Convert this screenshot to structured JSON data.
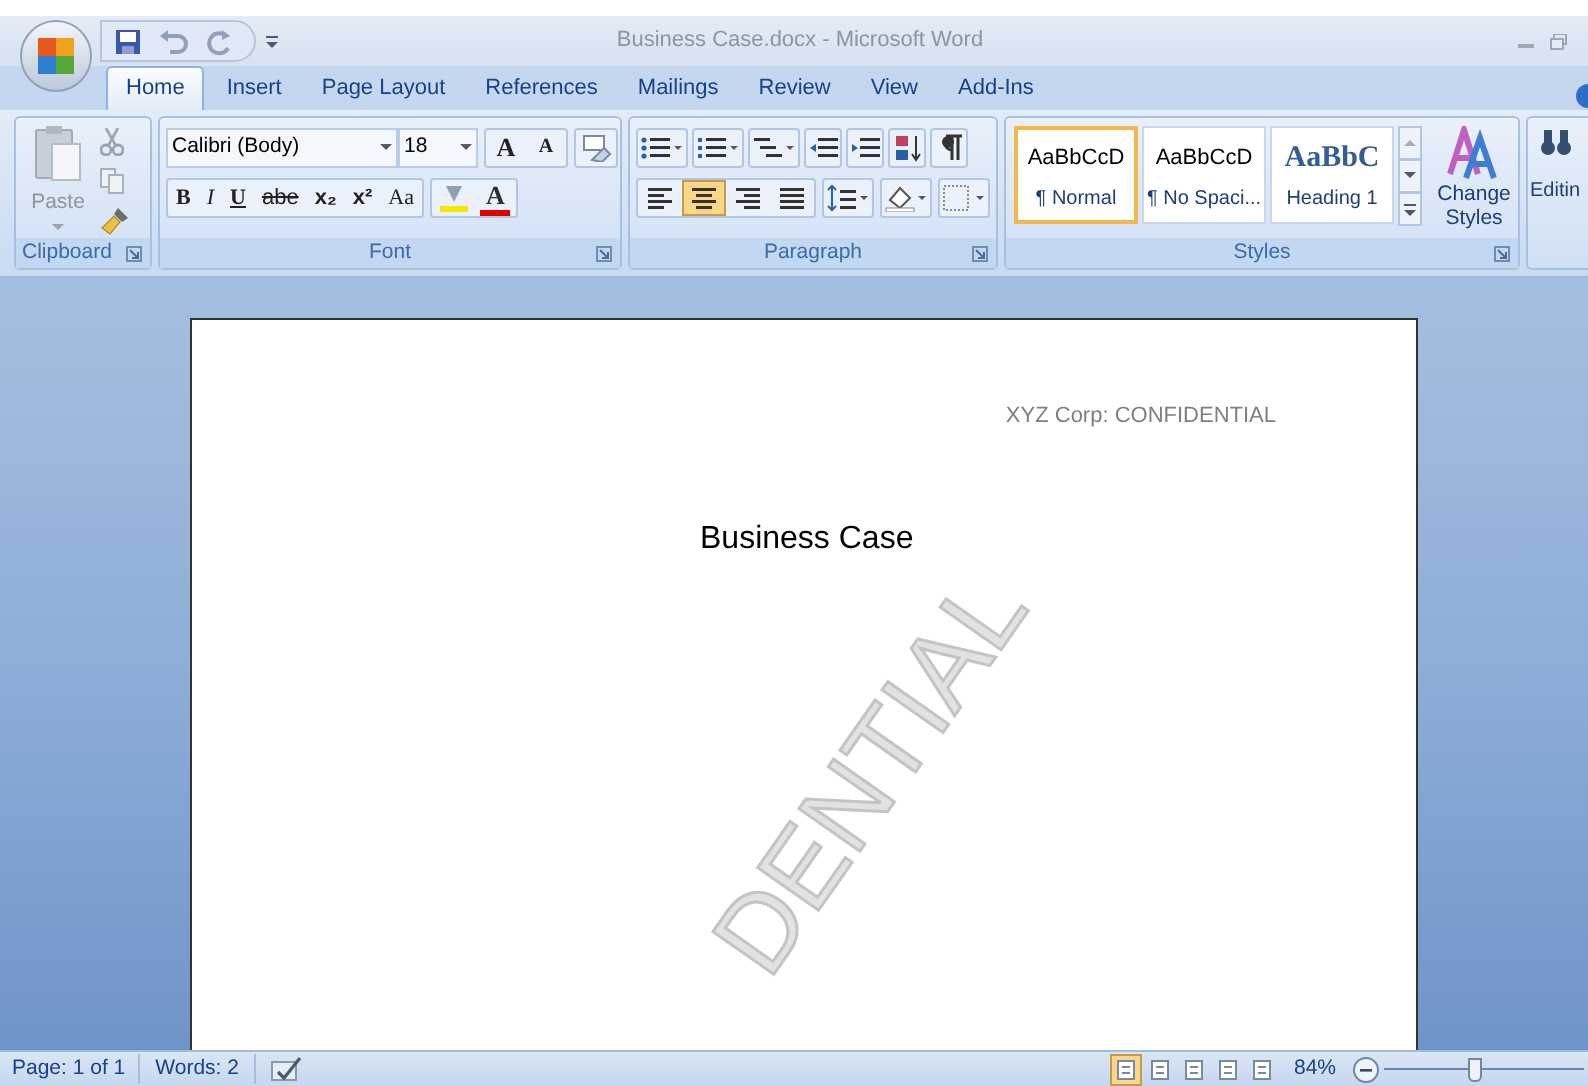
{
  "window": {
    "title": "Business Case.docx - Microsoft Word"
  },
  "tabs": [
    {
      "label": "Home",
      "selected": true
    },
    {
      "label": "Insert",
      "selected": false
    },
    {
      "label": "Page Layout",
      "selected": false
    },
    {
      "label": "References",
      "selected": false
    },
    {
      "label": "Mailings",
      "selected": false
    },
    {
      "label": "Review",
      "selected": false
    },
    {
      "label": "View",
      "selected": false
    },
    {
      "label": "Add-Ins",
      "selected": false
    }
  ],
  "clipboard": {
    "label": "Clipboard",
    "paste": "Paste"
  },
  "font": {
    "label": "Font",
    "font_name": "Calibri (Body)",
    "font_size": "18",
    "grow": "A",
    "shrink": "A",
    "format_buttons": [
      "B",
      "I",
      "U",
      "abe",
      "x₂",
      "x²",
      "Aa"
    ],
    "font_color": "A"
  },
  "paragraph": {
    "label": "Paragraph",
    "alignments": [
      {
        "kind": "left",
        "selected": false
      },
      {
        "kind": "center",
        "selected": true
      },
      {
        "kind": "right",
        "selected": false
      },
      {
        "kind": "justify",
        "selected": false
      }
    ]
  },
  "styles": {
    "label": "Styles",
    "items": [
      {
        "kind": "body",
        "preview": "AaBbCcD",
        "name": "¶ Normal",
        "selected": true
      },
      {
        "kind": "body",
        "preview": "AaBbCcD",
        "name": "¶ No Spaci...",
        "selected": false
      },
      {
        "kind": "heading",
        "preview": "AaBbC",
        "name": "Heading 1",
        "selected": false
      }
    ],
    "change_styles": "Change Styles"
  },
  "editing": {
    "label": "Editin"
  },
  "document": {
    "header": "XYZ Corp: CONFIDENTIAL",
    "title": "Business Case",
    "watermark": "DENTIAL"
  },
  "status_bar": {
    "page": "Page: 1 of 1",
    "words": "Words: 2",
    "views": [
      {
        "selected": true
      },
      {
        "selected": false
      },
      {
        "selected": false
      },
      {
        "selected": false
      },
      {
        "selected": false
      }
    ],
    "zoom": "84%",
    "zoom_slider": {
      "level": 0.45
    }
  }
}
